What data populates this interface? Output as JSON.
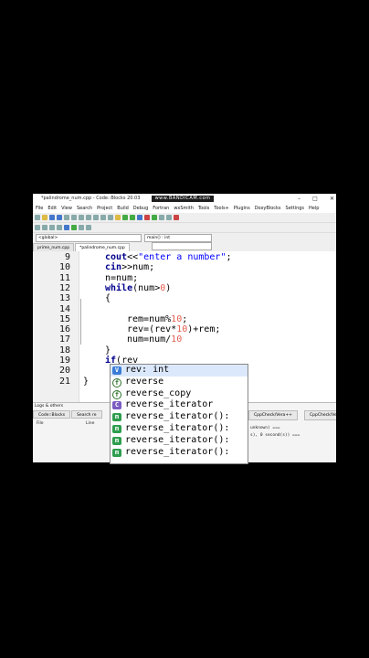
{
  "window": {
    "title": "*palindrome_num.cpp - Code::Blocks 20.03",
    "watermark": "www.BANDICAM.com"
  },
  "menu": [
    "File",
    "Edit",
    "View",
    "Search",
    "Project",
    "Build",
    "Debug",
    "Fortran",
    "wxSmith",
    "Tools",
    "Tools+",
    "Plugins",
    "DoxyBlocks",
    "Settings",
    "Help"
  ],
  "scope": {
    "left": "<global>",
    "right": "main() : int"
  },
  "file_tabs": [
    "prime_num.cpp",
    "*palindrome_num.cpp"
  ],
  "code_lines": [
    {
      "n": "9",
      "text": "cout<<\"enter a number\";"
    },
    {
      "n": "10",
      "text": "cin>>num;"
    },
    {
      "n": "11",
      "text": "n=num;"
    },
    {
      "n": "12",
      "text": "while(num>0)"
    },
    {
      "n": "13",
      "text": "{"
    },
    {
      "n": "14",
      "text": ""
    },
    {
      "n": "15",
      "text": "rem=num%10;"
    },
    {
      "n": "16",
      "text": "rev=(rev*10)+rem;"
    },
    {
      "n": "17",
      "text": "num=num/10"
    },
    {
      "n": "18",
      "text": "}"
    },
    {
      "n": "19",
      "text": "if(rev"
    },
    {
      "n": "20",
      "text": ""
    },
    {
      "n": "21",
      "text": "}"
    }
  ],
  "autocomplete": [
    {
      "icon": "variable-icon",
      "label": "rev: int"
    },
    {
      "icon": "function-icon",
      "label": "reverse"
    },
    {
      "icon": "function-icon",
      "label": "reverse_copy"
    },
    {
      "icon": "class-icon",
      "label": "reverse_iterator"
    },
    {
      "icon": "method-icon",
      "label": "reverse_iterator():"
    },
    {
      "icon": "method-icon",
      "label": "reverse_iterator():"
    },
    {
      "icon": "method-icon",
      "label": "reverse_iterator():"
    },
    {
      "icon": "method-icon",
      "label": "reverse_iterator():"
    }
  ],
  "logs": {
    "title": "Logs & others",
    "tabs": [
      "Code::Blocks",
      "Search re"
    ],
    "right_tabs": [
      "CppCheck/Vera++",
      "CppCheck/Vera"
    ],
    "columns": [
      "File",
      "Line"
    ],
    "lines": [
      "unknown) ===",
      "s), 0 second(s)) ==="
    ]
  }
}
